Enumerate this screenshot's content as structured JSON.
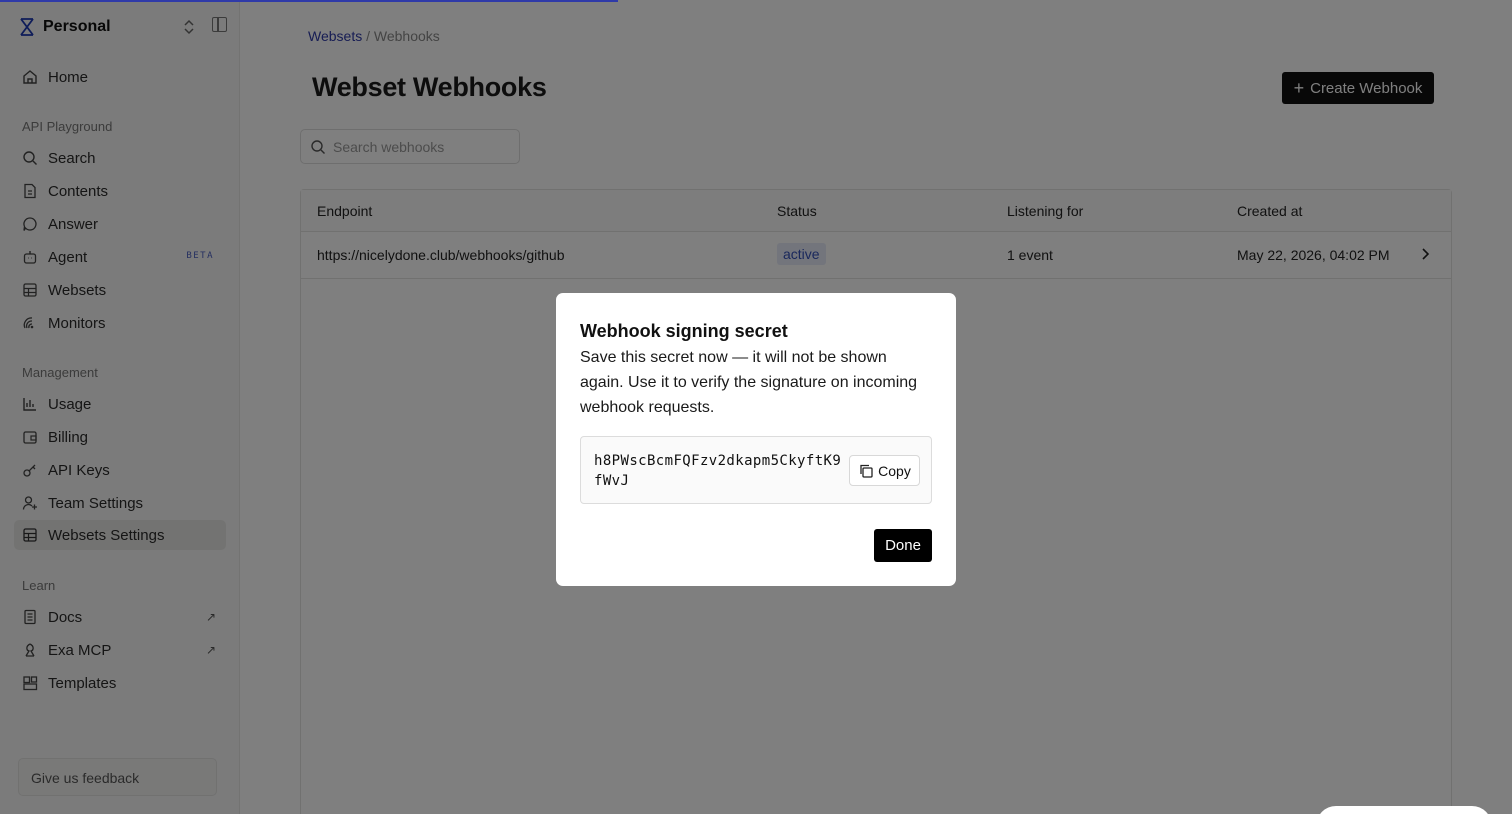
{
  "workspace": {
    "name": "Personal"
  },
  "sidebar": {
    "home": "Home",
    "sections": {
      "api_playground": "API Playground",
      "management": "Management",
      "learn": "Learn"
    },
    "api_items": [
      {
        "label": "Search",
        "icon": "search-icon"
      },
      {
        "label": "Contents",
        "icon": "document-icon"
      },
      {
        "label": "Answer",
        "icon": "chat-icon"
      },
      {
        "label": "Agent",
        "icon": "robot-icon",
        "badge": "BETA"
      },
      {
        "label": "Websets",
        "icon": "grid-icon"
      },
      {
        "label": "Monitors",
        "icon": "monitor-icon"
      }
    ],
    "management_items": [
      {
        "label": "Usage",
        "icon": "bar-chart-icon"
      },
      {
        "label": "Billing",
        "icon": "wallet-icon"
      },
      {
        "label": "API Keys",
        "icon": "key-icon"
      },
      {
        "label": "Team Settings",
        "icon": "user-plus-icon"
      },
      {
        "label": "Websets Settings",
        "icon": "grid-icon",
        "active": true
      }
    ],
    "learn_items": [
      {
        "label": "Docs",
        "icon": "book-icon",
        "external": true
      },
      {
        "label": "Exa MCP",
        "icon": "plug-icon",
        "external": true
      },
      {
        "label": "Templates",
        "icon": "templates-icon"
      }
    ],
    "feedback_label": "Give us feedback"
  },
  "breadcrumb": {
    "parent": "Websets",
    "separator": " / ",
    "current": "Webhooks"
  },
  "page": {
    "title": "Webset Webhooks",
    "create_button": "Create Webhook",
    "search_placeholder": "Search webhooks"
  },
  "table": {
    "headers": [
      "Endpoint",
      "Status",
      "Listening for",
      "Created at"
    ],
    "rows": [
      {
        "endpoint": "https://nicelydone.club/webhooks/github",
        "status": "active",
        "listening_for": "1 event",
        "created_at": "May 22, 2026, 04:02 PM"
      }
    ]
  },
  "modal": {
    "title": "Webhook signing secret",
    "description": "Save this secret now — it will not be shown again. Use it to verify the signature on incoming webhook requests.",
    "secret": "h8PWscBcmFQFzv2dkapm5CkyftK9fWvJ",
    "copy_label": "Copy",
    "done_label": "Done"
  },
  "colors": {
    "accent": "#2f3aa8",
    "status_bg": "#e6ebf8",
    "status_text": "#3450b8",
    "primary_button": "#111111"
  }
}
